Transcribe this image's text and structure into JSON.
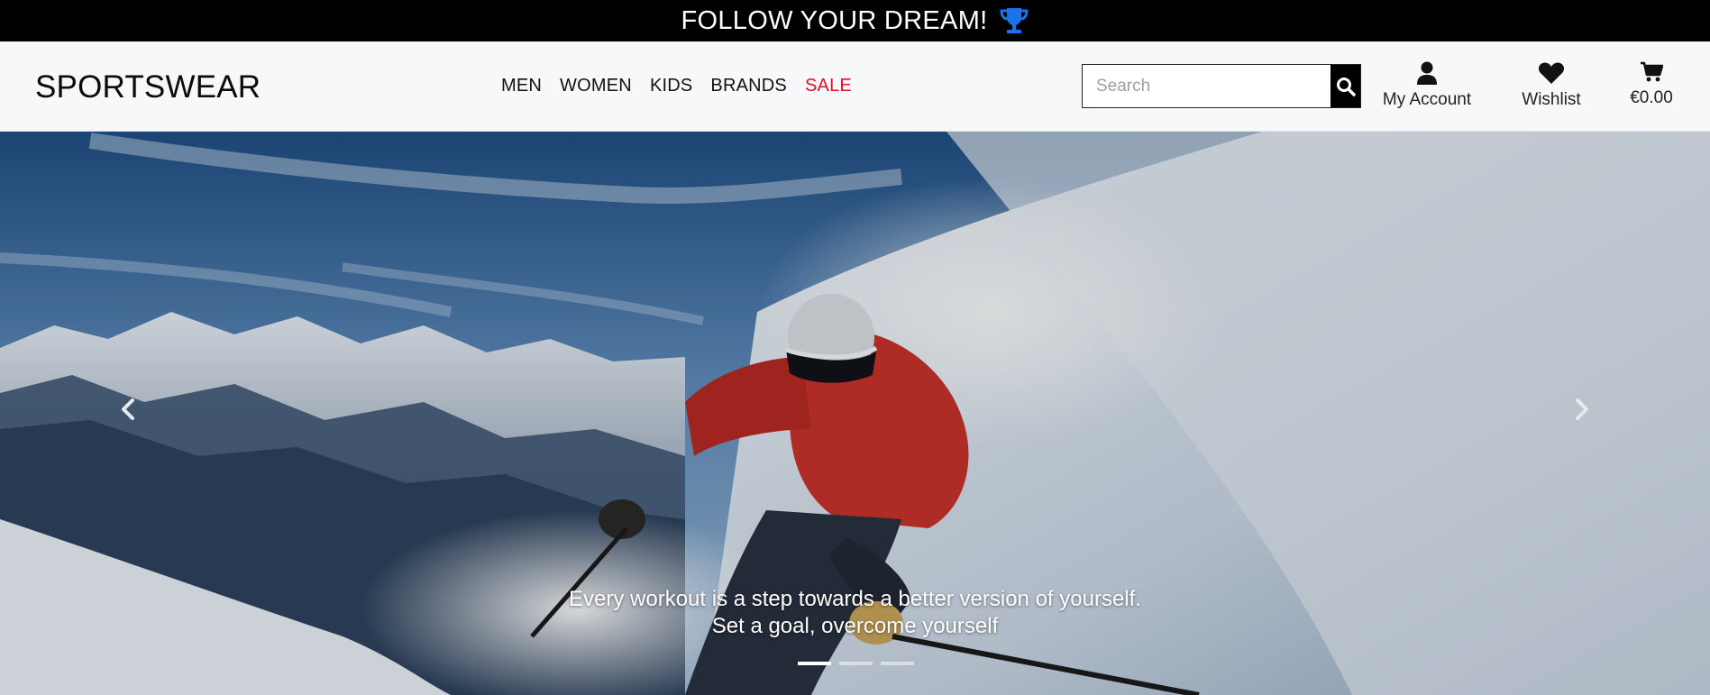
{
  "banner": {
    "text": "FOLLOW YOUR DREAM!",
    "icon": "trophy-icon",
    "icon_color": "#1a73e8"
  },
  "header": {
    "logo": "SPORTSWEAR",
    "nav": [
      {
        "label": "MEN"
      },
      {
        "label": "WOMEN"
      },
      {
        "label": "KIDS"
      },
      {
        "label": "BRANDS"
      },
      {
        "label": "SALE",
        "color": "#e0112b"
      }
    ],
    "search": {
      "placeholder": "Search",
      "value": "",
      "button_icon": "search-icon"
    },
    "account": {
      "label": "My Account",
      "icon": "user-icon"
    },
    "wishlist": {
      "label": "Wishlist",
      "icon": "heart-icon"
    },
    "bag": {
      "label": "€0.00",
      "icon": "cart-icon"
    }
  },
  "hero": {
    "caption_line1": "Every workout is a step towards a better version of yourself.",
    "caption_line2": "Set a goal, overcome yourself",
    "prev_icon": "chevron-left-icon",
    "next_icon": "chevron-right-icon",
    "slides": 3,
    "active_slide": 1
  }
}
